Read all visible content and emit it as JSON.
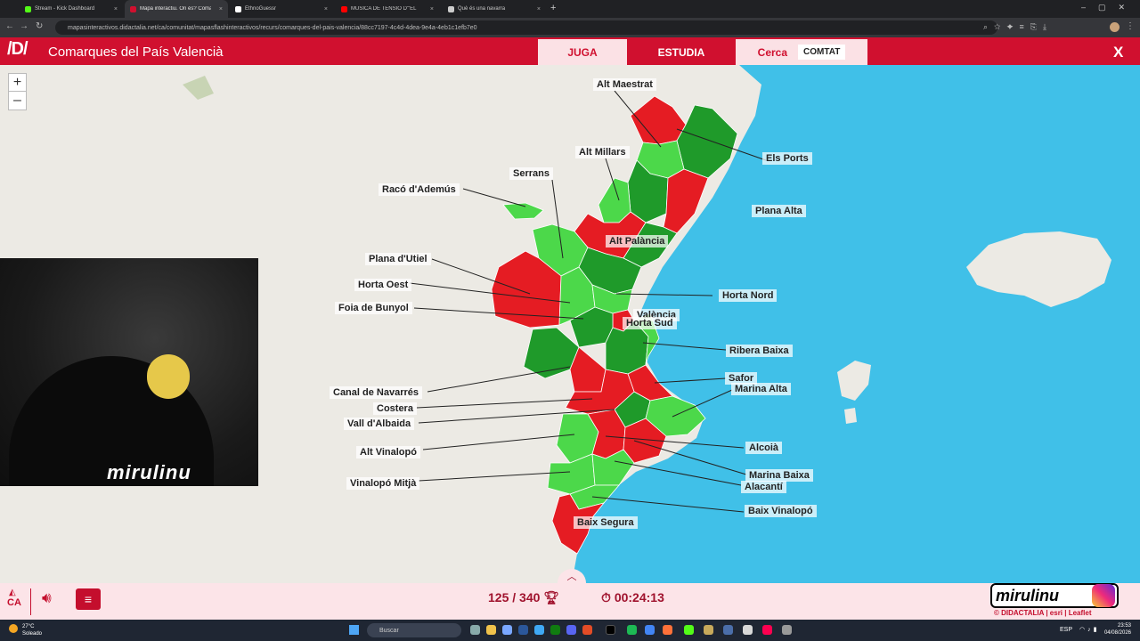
{
  "browser": {
    "tabs": [
      {
        "label": "Stream - Kick Dashboard",
        "color": "#53fc18"
      },
      {
        "label": "Mapa interactiu. On és? Comar",
        "color": "#d0102f"
      },
      {
        "label": "EthnoGuessr",
        "color": "#ffffff"
      },
      {
        "label": "MÚSICA DE TENSIÓ D'\"EL",
        "color": "#ff0000"
      },
      {
        "label": "Què és una navarra",
        "color": "#cccccc"
      }
    ],
    "url": "mapasinteractivos.didactalia.net/ca/comunitat/mapasflashinteractivos/recurs/comarques-del-pais-valencia/88cc7197-4c4d-4dea-9e4a-4eb1c1efb7e0"
  },
  "app": {
    "logo": "/D/",
    "title": "Comarques del País Valencià",
    "modes": {
      "play": "JUGA",
      "study": "ESTUDIA",
      "search": "Cerca",
      "county": "COMTAT"
    },
    "close": "X"
  },
  "map": {
    "zoom_in": "+",
    "zoom_out": "–",
    "labels": {
      "alt_maestrat": "Alt Maestrat",
      "els_ports": "Els Ports",
      "alt_millars": "Alt Millars",
      "serrans": "Serrans",
      "raco": "Racó d'Ademús",
      "plana_alta": "Plana Alta",
      "alt_palancia": "Alt Palància",
      "plana_utiel": "Plana d'Utiel",
      "horta_oest": "Horta Oest",
      "horta_nord": "Horta Nord",
      "foia_bunyol": "Foia de Bunyol",
      "valencia": "València",
      "horta_sud": "Horta Sud",
      "ribera_baixa": "Ribera Baixa",
      "safor": "Safor",
      "marina_alta": "Marina Alta",
      "canal_navarres": "Canal de Navarrés",
      "costera": "Costera",
      "vall_albaida": "Vall d'Albaida",
      "alcoia": "Alcoià",
      "alt_vinalopo": "Alt Vinalopó",
      "marina_baixa": "Marina Baixa",
      "alacanti": "Alacantí",
      "vinalopo_mitja": "Vinalopó Mitjà",
      "baix_vinalopo": "Baix Vinalopó",
      "baix_segura": "Baix Segura"
    },
    "colors": {
      "sea": "#40c0e8",
      "land": "#eceae4",
      "correct": "#1f9a2a",
      "light": "#4cd84a",
      "wrong": "#e51c23"
    }
  },
  "stream": {
    "overlay": "mirulinu",
    "brand": "mirulinu",
    "sub": "© DIDACTALIA | esri | Leaflet"
  },
  "bottom": {
    "lang": "CA",
    "score": "125 / 340",
    "timer": "00:24:13"
  },
  "taskbar": {
    "weather_temp": "27°C",
    "weather_desc": "Soleado",
    "search": "Buscar",
    "lang": "ESP",
    "time": "23:53",
    "date": "04/08/2026"
  }
}
